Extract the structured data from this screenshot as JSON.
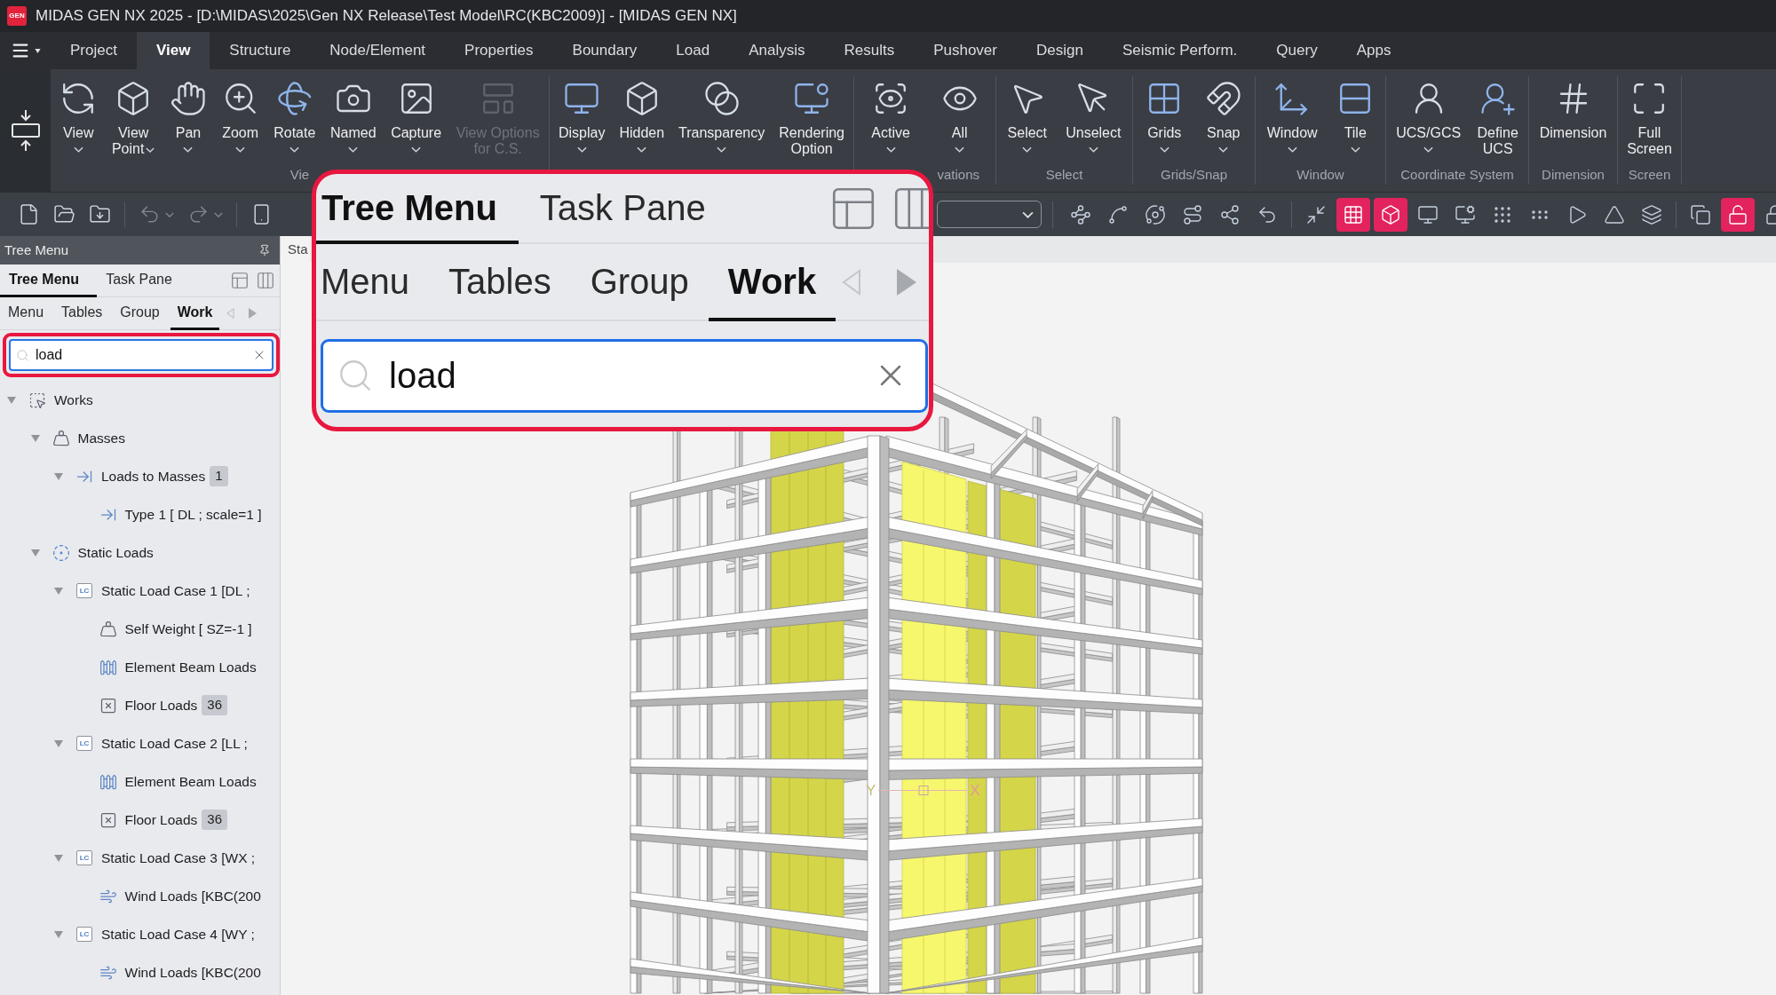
{
  "title_bar": {
    "app_badge": "GEN",
    "title": "MIDAS GEN NX 2025 - [D:\\MIDAS\\2025\\Gen NX Release\\Test Model\\RC(KBC2009)] - [MIDAS GEN NX]"
  },
  "menu_tabs": [
    {
      "label": "Project",
      "selected": false
    },
    {
      "label": "View",
      "selected": true
    },
    {
      "label": "Structure",
      "selected": false
    },
    {
      "label": "Node/Element",
      "selected": false
    },
    {
      "label": "Properties",
      "selected": false
    },
    {
      "label": "Boundary",
      "selected": false
    },
    {
      "label": "Load",
      "selected": false
    },
    {
      "label": "Analysis",
      "selected": false
    },
    {
      "label": "Results",
      "selected": false
    },
    {
      "label": "Pushover",
      "selected": false
    },
    {
      "label": "Design",
      "selected": false
    },
    {
      "label": "Seismic Perform.",
      "selected": false
    },
    {
      "label": "Query",
      "selected": false
    },
    {
      "label": "Apps",
      "selected": false
    }
  ],
  "ribbon": {
    "groups": [
      {
        "label": "Vie",
        "items": [
          {
            "label_lines": [
              "View"
            ],
            "dropdown": true,
            "disabled": false
          },
          {
            "label_lines": [
              "View",
              "Point"
            ],
            "dropdown": true,
            "disabled": false
          },
          {
            "label_lines": [
              "Pan"
            ],
            "dropdown": true,
            "disabled": false
          },
          {
            "label_lines": [
              "Zoom"
            ],
            "dropdown": true,
            "disabled": false
          },
          {
            "label_lines": [
              "Rotate"
            ],
            "dropdown": true,
            "disabled": false
          },
          {
            "label_lines": [
              "Named"
            ],
            "dropdown": true,
            "disabled": false
          },
          {
            "label_lines": [
              "Capture"
            ],
            "dropdown": true,
            "disabled": false
          },
          {
            "label_lines": [
              "View Options",
              "for C.S."
            ],
            "dropdown": false,
            "disabled": true
          }
        ]
      },
      {
        "items": [
          {
            "label_lines": [
              "Display"
            ],
            "dropdown": true,
            "disabled": false
          },
          {
            "label_lines": [
              "Hidden"
            ],
            "dropdown": true,
            "disabled": false
          },
          {
            "label_lines": [
              "Transparency"
            ],
            "dropdown": true,
            "disabled": false
          },
          {
            "label_lines": [
              "Rendering",
              "Option"
            ],
            "dropdown": false,
            "disabled": false
          }
        ]
      },
      {
        "label": "vations",
        "items": [
          {
            "label_lines": [
              "Active"
            ],
            "dropdown": true,
            "disabled": false
          },
          {
            "label_lines": [
              "All"
            ],
            "dropdown": true,
            "disabled": false
          }
        ]
      },
      {
        "label": "Select",
        "items": [
          {
            "label_lines": [
              "Select"
            ],
            "dropdown": true,
            "disabled": false
          },
          {
            "label_lines": [
              "Unselect"
            ],
            "dropdown": true,
            "disabled": false
          }
        ]
      },
      {
        "label": "Grids/Snap",
        "items": [
          {
            "label_lines": [
              "Grids"
            ],
            "dropdown": true,
            "disabled": false
          },
          {
            "label_lines": [
              "Snap"
            ],
            "dropdown": true,
            "disabled": false
          }
        ]
      },
      {
        "label": "Window",
        "items": [
          {
            "label_lines": [
              "Window"
            ],
            "dropdown": true,
            "disabled": false
          },
          {
            "label_lines": [
              "Tile"
            ],
            "dropdown": true,
            "disabled": false
          }
        ]
      },
      {
        "label": "Coordinate System",
        "items": [
          {
            "label_lines": [
              "UCS/GCS"
            ],
            "dropdown": true,
            "disabled": false
          },
          {
            "label_lines": [
              "Define",
              "UCS"
            ],
            "dropdown": false,
            "disabled": false
          }
        ]
      },
      {
        "label": "Dimension",
        "items": [
          {
            "label_lines": [
              "Dimension"
            ],
            "dropdown": false,
            "disabled": false
          }
        ]
      },
      {
        "label": "Screen",
        "items": [
          {
            "label_lines": [
              "Full",
              "Screen"
            ],
            "dropdown": false,
            "disabled": false
          }
        ]
      }
    ]
  },
  "quick_access": [
    {
      "disabled": false,
      "dropdown": false
    },
    {
      "disabled": false,
      "dropdown": false
    },
    {
      "disabled": false,
      "dropdown": false
    },
    {
      "disabled": true,
      "dropdown": true
    },
    {
      "disabled": true,
      "dropdown": true
    },
    {
      "disabled": false,
      "dropdown": false
    }
  ],
  "view_toolbar": [
    {
      "buttons": [
        {
          "active": false
        },
        {
          "active": false
        },
        {
          "active": false
        },
        {
          "active": false
        },
        {
          "active": false
        },
        {
          "active": false
        }
      ]
    },
    {
      "buttons": [
        {
          "active": false
        },
        {
          "active": true
        },
        {
          "active": true
        },
        {
          "active": false
        },
        {
          "active": false
        },
        {
          "active": false
        },
        {
          "active": false
        },
        {
          "active": false
        },
        {
          "active": false
        },
        {
          "active": false
        }
      ]
    },
    {
      "buttons": [
        {
          "active": false
        },
        {
          "active": true
        },
        {
          "active": false
        }
      ]
    }
  ],
  "tree_panel": {
    "title": "Tree Menu",
    "tabs": [
      {
        "label": "Tree Menu",
        "selected": true
      },
      {
        "label": "Task Pane",
        "selected": false
      }
    ],
    "sub_tabs": [
      {
        "label": "Menu",
        "selected": false
      },
      {
        "label": "Tables",
        "selected": false
      },
      {
        "label": "Group",
        "selected": false
      },
      {
        "label": "Work",
        "selected": true
      }
    ],
    "search": {
      "value": "load"
    },
    "tree": [
      {
        "kind": "works",
        "label": "Works",
        "expanded": true,
        "children": [
          {
            "kind": "mass",
            "label": "Masses",
            "expanded": true,
            "children": [
              {
                "kind": "conversion",
                "label": "Loads to Masses",
                "badge": "1",
                "expanded": true,
                "children": [
                  {
                    "kind": "conversion",
                    "label": "Type 1 [ DL ; scale=1 ]"
                  }
                ]
              }
            ]
          },
          {
            "kind": "static",
            "label": "Static Loads",
            "expanded": true,
            "children": [
              {
                "kind": "case",
                "icon_text": "LC",
                "label": "Static Load Case 1 [DL ;",
                "expanded": true,
                "children": [
                  {
                    "kind": "selfweight",
                    "label": "Self Weight [ SZ=-1 ]"
                  },
                  {
                    "kind": "beamload",
                    "label": "Element Beam Loads"
                  },
                  {
                    "kind": "floorload",
                    "label": "Floor Loads",
                    "badge": "36"
                  }
                ]
              },
              {
                "kind": "case",
                "icon_text": "LC",
                "label": "Static Load Case 2 [LL ;",
                "expanded": true,
                "children": [
                  {
                    "kind": "beamload",
                    "label": "Element Beam Loads"
                  },
                  {
                    "kind": "floorload",
                    "label": "Floor Loads",
                    "badge": "36"
                  }
                ]
              },
              {
                "kind": "case",
                "icon_text": "LC",
                "label": "Static Load Case 3 [WX ;",
                "expanded": true,
                "children": [
                  {
                    "kind": "windload",
                    "label": "Wind Loads [KBC(200"
                  }
                ]
              },
              {
                "kind": "case",
                "icon_text": "LC",
                "label": "Static Load Case 4 [WY ;",
                "expanded": true,
                "children": [
                  {
                    "kind": "windload",
                    "label": "Wind Loads [KBC(200"
                  }
                ]
              }
            ]
          }
        ]
      }
    ]
  },
  "document_tab": {
    "label": "Sta"
  },
  "model_view": {
    "axis_labels": [
      "Y",
      "X"
    ]
  },
  "zoom_callout": {
    "tabs": [
      {
        "label": "Tree Menu",
        "selected": true
      },
      {
        "label": "Task Pane",
        "selected": false
      }
    ],
    "sub_tabs": [
      {
        "label": "Menu",
        "selected": false
      },
      {
        "label": "Tables",
        "selected": false
      },
      {
        "label": "Group",
        "selected": false
      },
      {
        "label": "Work",
        "selected": true
      }
    ],
    "search": {
      "value": "load"
    }
  }
}
